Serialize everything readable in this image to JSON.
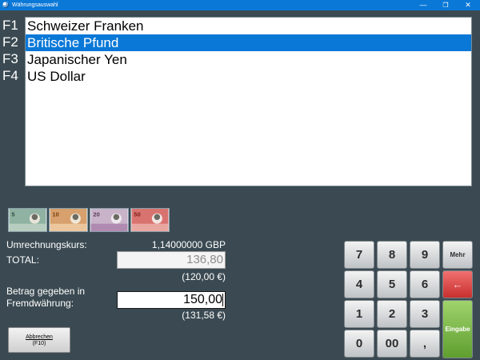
{
  "window": {
    "title": "Währungsauswahl",
    "minimize_glyph": "—",
    "maximize_glyph": "❐",
    "close_glyph": "✕"
  },
  "currencies": [
    {
      "key": "F1",
      "name": "Schweizer Franken",
      "selected": false
    },
    {
      "key": "F2",
      "name": "Britische Pfund",
      "selected": true
    },
    {
      "key": "F3",
      "name": "Japanischer Yen",
      "selected": false
    },
    {
      "key": "F4",
      "name": "US Dollar",
      "selected": false
    }
  ],
  "banknotes": [
    {
      "icon": "gbp-5-banknote-icon",
      "numeral": "5",
      "color": "#8fb2a2"
    },
    {
      "icon": "gbp-10-banknote-icon",
      "numeral": "10",
      "color": "#d7a06c"
    },
    {
      "icon": "gbp-20-banknote-icon",
      "numeral": "20",
      "color": "#b08ab1"
    },
    {
      "icon": "gbp-50-banknote-icon",
      "numeral": "50",
      "color": "#d9736f"
    }
  ],
  "summary": {
    "rate_label": "Umrechnungskurs:",
    "rate_value": "1,14000000 GBP",
    "total_label": "TOTAL:",
    "total_value": "136,80",
    "total_base": "(120,00 €)",
    "given_label_line1": "Betrag gegeben in",
    "given_label_line2": "Fremdwährung:",
    "given_value": "150,00",
    "given_base": "(131,58 €)"
  },
  "cancel_button": {
    "label_line1": "Abbrechen",
    "label_line2": "(F10)"
  },
  "keypad": {
    "k7": "7",
    "k8": "8",
    "k9": "9",
    "more": "Mehr",
    "k4": "4",
    "k5": "5",
    "k6": "6",
    "backspace": "←",
    "k1": "1",
    "k2": "2",
    "k3": "3",
    "enter": "Eingabe",
    "k0": "0",
    "k00": "00",
    "comma": ","
  },
  "colors": {
    "background": "#3b4a52",
    "selection": "#0a78d7",
    "backspace_key": "#c8302e",
    "enter_key": "#6aa836"
  }
}
